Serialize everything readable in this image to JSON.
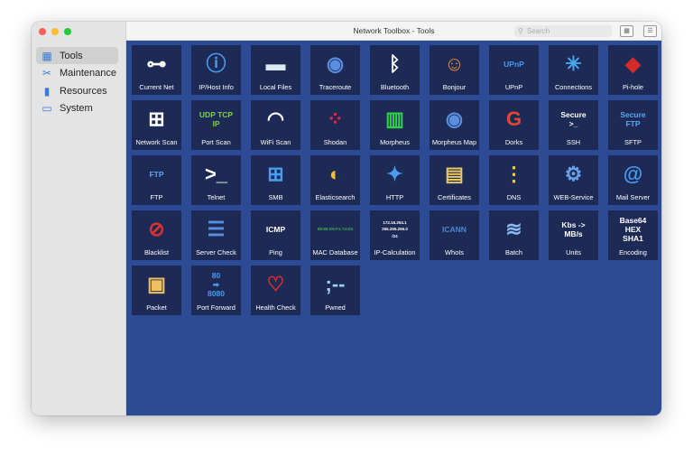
{
  "window": {
    "title": "Network Toolbox - Tools",
    "search_placeholder": "Search",
    "grid_view_icon": "grid-icon",
    "list_view_icon": "list-icon"
  },
  "sidebar": {
    "items": [
      {
        "label": "Tools",
        "icon": "grid-icon",
        "glyph": "▦",
        "active": true
      },
      {
        "label": "Maintenance",
        "icon": "tools-icon",
        "glyph": "✂",
        "active": false
      },
      {
        "label": "Resources",
        "icon": "books-icon",
        "glyph": "▮",
        "active": false
      },
      {
        "label": "System",
        "icon": "monitor-icon",
        "glyph": "▭",
        "active": false
      }
    ]
  },
  "colors": {
    "main_bg": "#2d4b94",
    "tile_bg": "#1e2a56",
    "accent": "#3a7bd5"
  },
  "tools": [
    {
      "label": "Current Net",
      "icon": "network-tree-icon",
      "glyph": "⊶",
      "color": "#ffffff"
    },
    {
      "label": "IP/Host Info",
      "icon": "info-icon",
      "glyph": "ⓘ",
      "color": "#4a9cf0"
    },
    {
      "label": "Local Files",
      "icon": "folder-icon",
      "glyph": "▬",
      "color": "#dde8f5"
    },
    {
      "label": "Traceroute",
      "icon": "world-map-icon",
      "glyph": "◉",
      "color": "#5a8fe0"
    },
    {
      "label": "Bluetooth",
      "icon": "bluetooth-icon",
      "glyph": "ᛒ",
      "color": "#ffffff"
    },
    {
      "label": "Bonjour",
      "icon": "bonjour-icon",
      "glyph": "☺",
      "color": "#e58a40"
    },
    {
      "label": "UPnP",
      "icon": "upnp-icon",
      "text": "UPnP",
      "color": "#4a9cf0"
    },
    {
      "label": "Connections",
      "icon": "connections-icon",
      "glyph": "✳",
      "color": "#4aa8f0"
    },
    {
      "label": "Pi-hole",
      "icon": "pihole-icon",
      "glyph": "◆",
      "color": "#d42a2a"
    },
    {
      "label": "Network Scan",
      "icon": "hierarchy-icon",
      "glyph": "⊞",
      "color": "#ffffff"
    },
    {
      "label": "Port Scan",
      "icon": "ports-icon",
      "text": "UDP TCP\nIP",
      "color": "#7fd04a"
    },
    {
      "label": "WiFi Scan",
      "icon": "wifi-icon",
      "glyph": "◠",
      "color": "#ffffff"
    },
    {
      "label": "Shodan",
      "icon": "shodan-icon",
      "glyph": "⁘",
      "color": "#e03030"
    },
    {
      "label": "Morpheus",
      "icon": "matrix-icon",
      "glyph": "▥",
      "color": "#2fd04a"
    },
    {
      "label": "Morpheus Map",
      "icon": "world-map-icon",
      "glyph": "◉",
      "color": "#5a8fe0"
    },
    {
      "label": "Dorks",
      "icon": "google-icon",
      "glyph": "G",
      "color": "#ea4335"
    },
    {
      "label": "SSH",
      "icon": "terminal-icon",
      "text": "Secure\n>_",
      "color": "#ffffff"
    },
    {
      "label": "SFTP",
      "icon": "sftp-icon",
      "text": "Secure\nFTP",
      "color": "#5aa8f0"
    },
    {
      "label": "FTP",
      "icon": "ftp-icon",
      "text": "FTP",
      "color": "#5aa8f0"
    },
    {
      "label": "Telnet",
      "icon": "terminal-icon",
      "glyph": ">_",
      "color": "#ffffff"
    },
    {
      "label": "SMB",
      "icon": "windows-icon",
      "glyph": "⊞",
      "color": "#4a9cf0"
    },
    {
      "label": "Elasticsearch",
      "icon": "elasticsearch-icon",
      "glyph": "◐",
      "color": "#f0c030"
    },
    {
      "label": "HTTP",
      "icon": "compass-icon",
      "glyph": "✦",
      "color": "#4a9cf0"
    },
    {
      "label": "Certificates",
      "icon": "certificate-icon",
      "glyph": "▤",
      "color": "#e8c860"
    },
    {
      "label": "DNS",
      "icon": "dns-icon",
      "glyph": "⋮",
      "color": "#f0d040"
    },
    {
      "label": "WEB-Service",
      "icon": "web-service-icon",
      "glyph": "⚙",
      "color": "#6aa0f0"
    },
    {
      "label": "Mail Server",
      "icon": "at-icon",
      "glyph": "@",
      "color": "#4a9cf0"
    },
    {
      "label": "Blacklist",
      "icon": "blocked-mail-icon",
      "glyph": "⊘",
      "color": "#e03030"
    },
    {
      "label": "Server Check",
      "icon": "server-rack-icon",
      "glyph": "☰",
      "color": "#5a8fe0"
    },
    {
      "label": "Ping",
      "icon": "icmp-icon",
      "text": "ICMP",
      "color": "#ffffff"
    },
    {
      "label": "MAC Database",
      "icon": "network-card-icon",
      "tiny": "88:88:D5:F1:74:D3",
      "glyph": "▭",
      "color": "#3cb050"
    },
    {
      "label": "IP-Calculation",
      "icon": "ip-calc-icon",
      "tiny": "172.16.254.1\n255.255.255.0\n/24",
      "color": "#ffffff"
    },
    {
      "label": "WhoIs",
      "icon": "icann-icon",
      "text": "ICANN",
      "color": "#4a8ad0"
    },
    {
      "label": "Batch",
      "icon": "layers-icon",
      "glyph": "≋",
      "color": "#8ab8f0"
    },
    {
      "label": "Units",
      "icon": "units-icon",
      "text": "Kbs ->\nMB/s",
      "color": "#ffffff"
    },
    {
      "label": "Encoding",
      "icon": "encoding-icon",
      "text": "Base64\nHEX\nSHA1",
      "color": "#ffffff"
    },
    {
      "label": "Packet",
      "icon": "package-icon",
      "glyph": "▣",
      "color": "#f0c060"
    },
    {
      "label": "Port Forward",
      "icon": "arrow-right-icon",
      "text": "80\n➡\n8080",
      "color": "#4a9cf0"
    },
    {
      "label": "Health Check",
      "icon": "stethoscope-icon",
      "glyph": "♡",
      "color": "#e03030"
    },
    {
      "label": "Pwned",
      "icon": "pwned-icon",
      "glyph": ";--",
      "color": "#9ad0f0"
    }
  ]
}
